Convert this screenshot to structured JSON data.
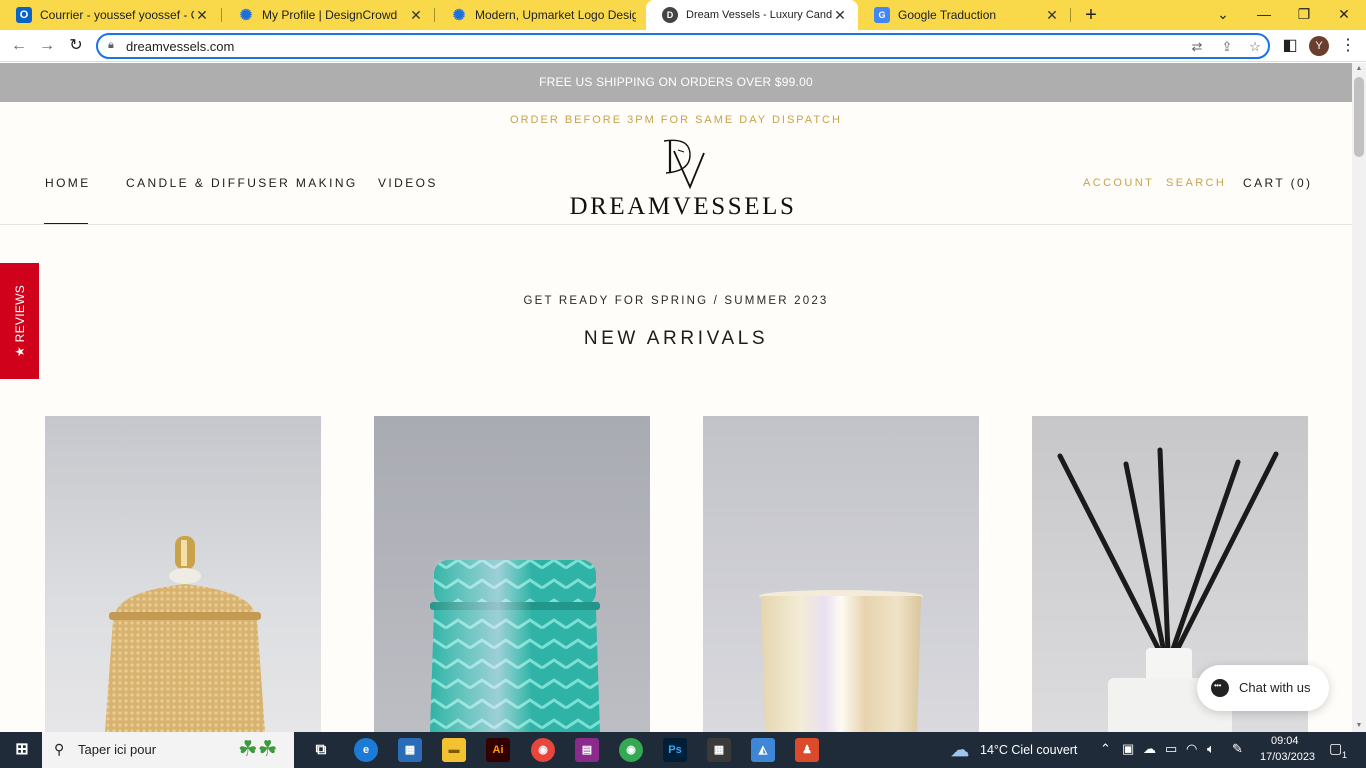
{
  "browser": {
    "tabs": [
      {
        "title": "Courrier - youssef yoossef - Outl",
        "icon": "outlook-icon",
        "active": false
      },
      {
        "title": "My Profile | DesignCrowd",
        "icon": "designcrowd-icon",
        "active": false
      },
      {
        "title": "Modern, Upmarket Logo Design",
        "icon": "designcrowd-icon",
        "active": false
      },
      {
        "title": "Dream Vessels - Luxury Candle C",
        "icon": "site-icon",
        "active": true
      },
      {
        "title": "Google Traduction",
        "icon": "google-translate-icon",
        "active": false
      }
    ],
    "new_tab_label": "+",
    "url": "dreamvessels.com",
    "profile_initial": "Y"
  },
  "site": {
    "announcement": "FREE US SHIPPING ON ORDERS OVER $99.00",
    "dispatch": "ORDER BEFORE 3PM FOR SAME DAY DISPATCH",
    "nav_left": [
      "HOME",
      "CANDLE & DIFFUSER MAKING",
      "VIDEOS"
    ],
    "logo_word": "DREAMVESSELS",
    "nav_right": {
      "account": "ACCOUNT",
      "search": "SEARCH",
      "cart": "CART (0)"
    },
    "reviews_tab": "★ REVIEWS",
    "kicker": "GET READY FOR SPRING / SUMMER 2023",
    "headline": "NEW ARRIVALS",
    "chat_label": "Chat with us",
    "colors": {
      "gold": "#c8a24a",
      "announcement_bg": "#aeaeae",
      "reviews_red": "#d0021b"
    }
  },
  "products": [
    {
      "icon": "gold-textured-jar-candle"
    },
    {
      "icon": "teal-chevron-jar-candle"
    },
    {
      "icon": "iridescent-tumbler-candle"
    },
    {
      "icon": "reed-diffuser"
    }
  ],
  "taskbar": {
    "search_placeholder": "Taper ici pour",
    "weather": "14°C  Ciel couvert",
    "time": "09:04",
    "date": "17/03/2023",
    "notifications": "1"
  }
}
